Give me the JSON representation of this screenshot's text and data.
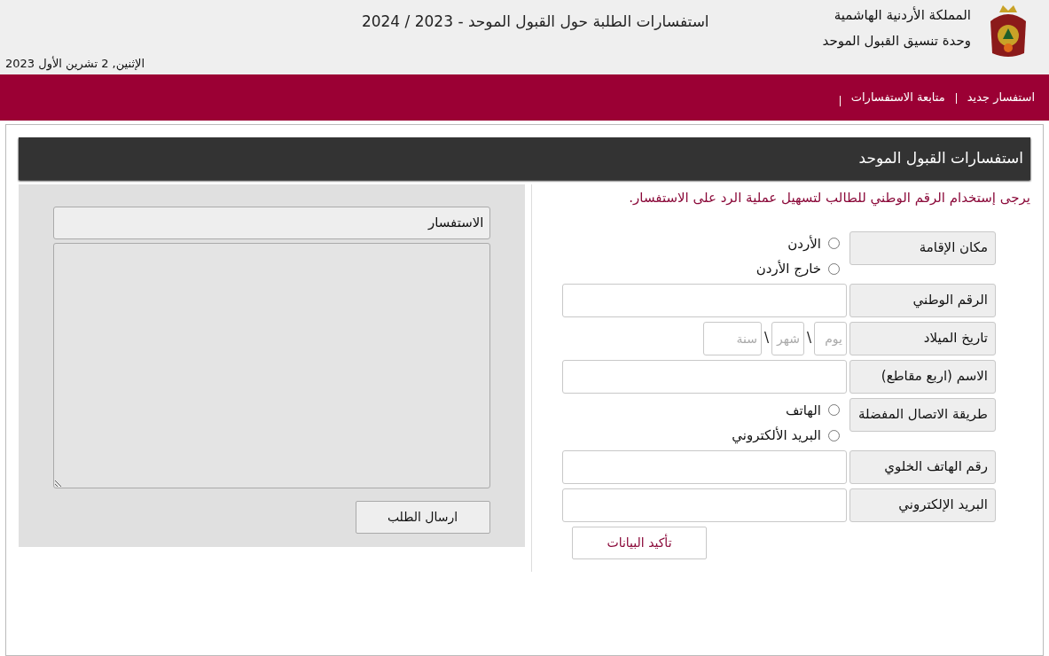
{
  "header": {
    "org_name": "المملكة الأردنية الهاشمية",
    "unit_name": "وحدة تنسيق القبول الموحد",
    "title": "استفسارات الطلبة حول القبول الموحد - 2023 / 2024",
    "date": "الإثنين, 2 تشرين الأول 2023"
  },
  "nav": [
    {
      "label": "استفسار جديد"
    },
    {
      "label": "متابعة الاستفسارات"
    }
  ],
  "panel_title": "استفسارات القبول الموحد",
  "notice": "يرجى إستخدام الرقم الوطني للطالب لتسهيل عملية الرد على الاستفسار.",
  "form": {
    "fields": [
      {
        "kind": "radio",
        "label": "مكان الإقامة",
        "options": [
          {
            "label": "الأردن",
            "selected": false
          },
          {
            "label": "خارج الأردن",
            "selected": false
          }
        ]
      },
      {
        "kind": "text",
        "label": "الرقم الوطني"
      },
      {
        "kind": "date",
        "label": "تاريخ الميلاد",
        "separator": "\\",
        "parts": [
          {
            "placeholder": "يوم"
          },
          {
            "placeholder": "شهر"
          },
          {
            "placeholder": "سنة"
          }
        ]
      },
      {
        "kind": "text",
        "label": "الاسم (اربع مقاطع)"
      },
      {
        "kind": "radio",
        "label": "طريقة الاتصال المفضلة",
        "options": [
          {
            "label": "الهاتف",
            "selected": false
          },
          {
            "label": "البريد الألكتروني",
            "selected": false
          }
        ]
      },
      {
        "kind": "text",
        "label": "رقم الهاتف الخلوي"
      },
      {
        "kind": "text",
        "label": "البريد الإلكتروني"
      }
    ],
    "confirm_button": "تأكيد البيانات"
  },
  "inquiry": {
    "label": "الاستفسار",
    "send_button": "ارسال الطلب"
  }
}
